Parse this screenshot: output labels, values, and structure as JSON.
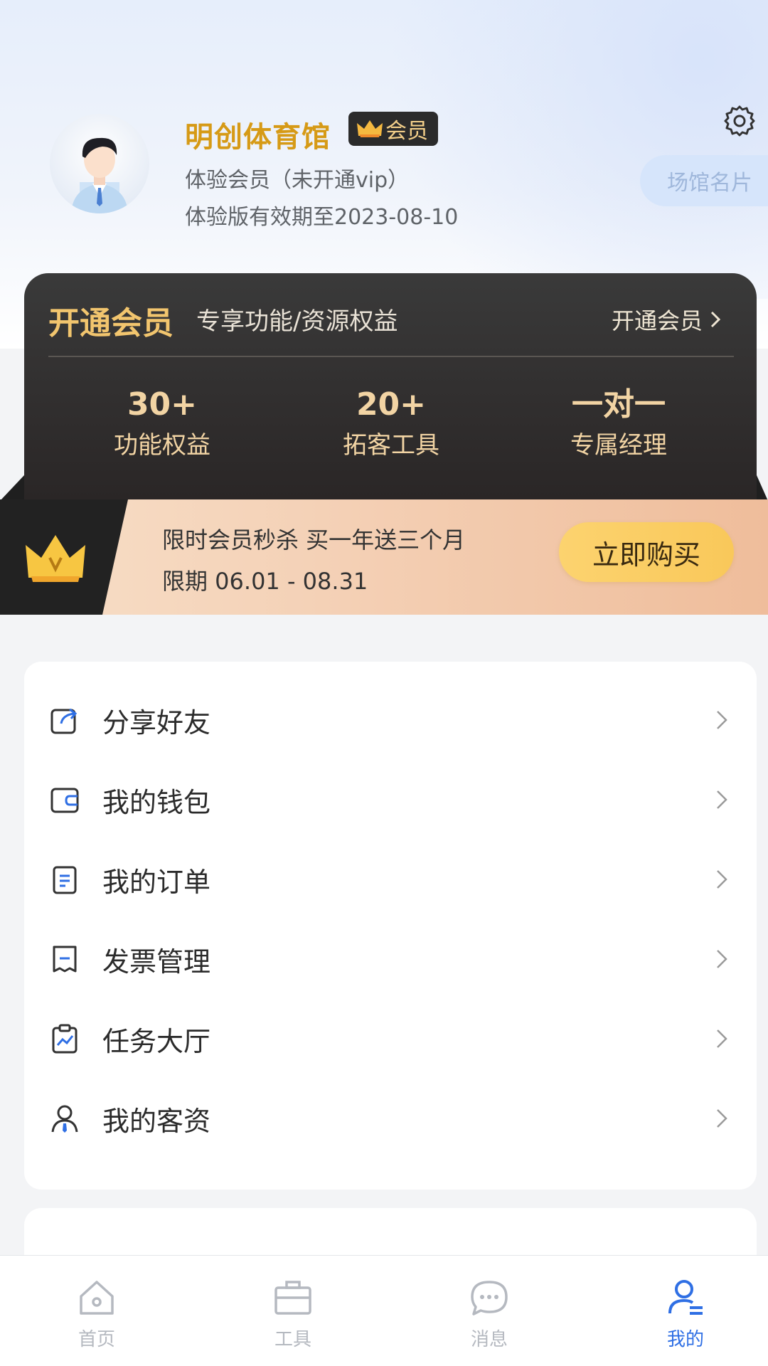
{
  "header": {
    "venue_name": "明创体育馆",
    "badge_label": "会员",
    "member_status": "体验会员（未开通vip）",
    "expiry": "体验版有效期至2023-08-10",
    "card_button": "场馆名片"
  },
  "vip": {
    "title": "开通会员",
    "subtitle": "专享功能/资源权益",
    "link": "开通会员",
    "benefits": [
      {
        "value": "30+",
        "label": "功能权益"
      },
      {
        "value": "20+",
        "label": "拓客工具"
      },
      {
        "value": "一对一",
        "label": "专属经理"
      }
    ]
  },
  "promo": {
    "line1": "限时会员秒杀 买一年送三个月",
    "line2": "限期 06.01 - 08.31",
    "button": "立即购买"
  },
  "menu": {
    "items": [
      {
        "label": "分享好友",
        "icon": "share-icon"
      },
      {
        "label": "我的钱包",
        "icon": "wallet-icon"
      },
      {
        "label": "我的订单",
        "icon": "order-icon"
      },
      {
        "label": "发票管理",
        "icon": "invoice-icon"
      },
      {
        "label": "任务大厅",
        "icon": "task-icon"
      },
      {
        "label": "我的客资",
        "icon": "customer-icon"
      }
    ]
  },
  "nav": {
    "items": [
      {
        "label": "首页",
        "icon": "home-icon"
      },
      {
        "label": "工具",
        "icon": "toolbox-icon"
      },
      {
        "label": "消息",
        "icon": "message-icon"
      },
      {
        "label": "我的",
        "icon": "profile-icon"
      }
    ],
    "active": "我的"
  },
  "colors": {
    "brand_gold": "#d69a16",
    "accent_blue": "#2f6fe4",
    "vip_dark": "#2e2a2a"
  }
}
